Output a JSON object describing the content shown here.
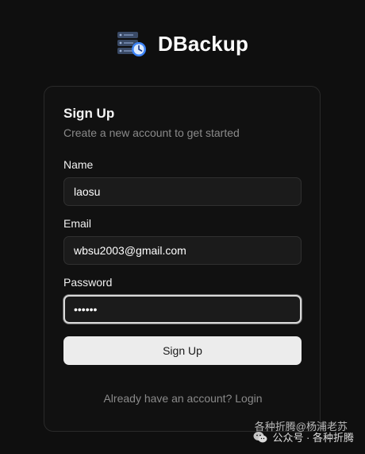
{
  "app": {
    "name": "DBackup",
    "logo_icon": "database-clock-icon"
  },
  "signup": {
    "title": "Sign Up",
    "subtitle": "Create a new account to get started",
    "fields": {
      "name": {
        "label": "Name",
        "value": "laosu"
      },
      "email": {
        "label": "Email",
        "value": "wbsu2003@gmail.com"
      },
      "password": {
        "label": "Password",
        "value": "••••••"
      }
    },
    "submit_label": "Sign Up",
    "login_link": "Already have an account? Login"
  },
  "watermark": {
    "line1": "各种折腾@杨浦老苏",
    "line2": "公众号 · 各种折腾",
    "icon": "wechat-icon"
  },
  "colors": {
    "background": "#0f0f0f",
    "card_border": "#2a2a2a",
    "input_bg": "#1b1b1b",
    "button_bg": "#ececec",
    "muted_text": "#8a8a8a",
    "logo_blue": "#3b82f6"
  }
}
